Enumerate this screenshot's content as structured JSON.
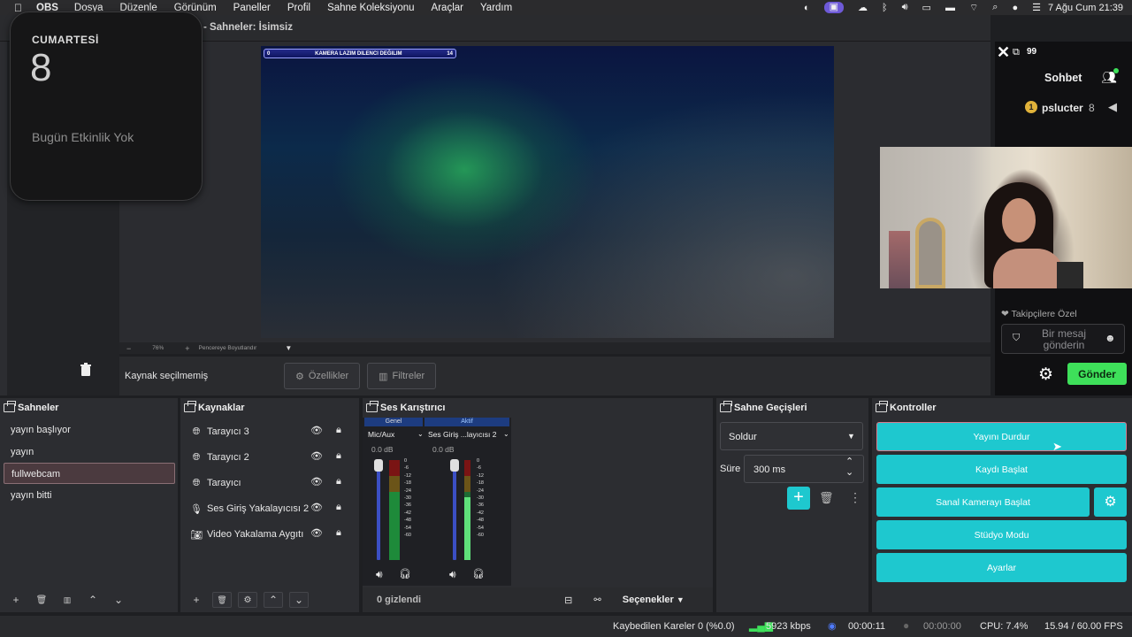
{
  "menubar": {
    "app_name": "OBS",
    "items": [
      "Dosya",
      "Düzenle",
      "Görünüm",
      "Paneller",
      "Profil",
      "Sahne Koleksiyonu",
      "Araçlar",
      "Yardım"
    ],
    "clock": "7 Ağu Cum  21:39"
  },
  "window": {
    "title": "- Sahneler: İsimsiz"
  },
  "calendar": {
    "weekday": "CUMARTESİ",
    "day": "8",
    "no_events": "Bugün Etkinlik Yok"
  },
  "preview": {
    "scoreboard": {
      "left": "0",
      "text": "KAMERA LAZIM DILENCI DEĞILIM",
      "right": "14"
    },
    "zoom": {
      "minus": "−",
      "level": "76%",
      "plus": "+",
      "fit": "Pencereye Boyutlandır"
    }
  },
  "source_toolbar": {
    "label": "Kaynak seçilmemiş",
    "properties": "Özellikler",
    "filters": "Filtreler"
  },
  "chat": {
    "count": "99",
    "title": "Sohbet",
    "message_user": "pslucter",
    "message_num": "8",
    "badge": "1",
    "followers_only": "Takipçilere Özel",
    "input_placeholder": "Bir mesaj gönderin",
    "send": "Gönder"
  },
  "scenes": {
    "title": "Sahneler",
    "items": [
      "yayın başlıyor",
      "yayın",
      "fullwebcam",
      "yayın bitti"
    ],
    "selected_index": 2
  },
  "sources": {
    "title": "Kaynaklar",
    "items": [
      {
        "label": "Tarayıcı 3",
        "icon": "globe-icon"
      },
      {
        "label": "Tarayıcı 2",
        "icon": "globe-icon"
      },
      {
        "label": "Tarayıcı",
        "icon": "globe-icon"
      },
      {
        "label": "Ses Giriş Yakalayıcısı 2",
        "icon": "microphone-icon"
      },
      {
        "label": "Video Yakalama Aygıtı",
        "icon": "camera-icon"
      }
    ]
  },
  "mixer": {
    "title": "Ses Karıştırıcı",
    "tabs": [
      "Genel",
      "Aktif"
    ],
    "channels": [
      {
        "name": "Mic/Aux",
        "db": "0.0 dB"
      },
      {
        "name": "Ses Giriş ...layıcısı 2",
        "db": "0.0 dB"
      }
    ],
    "scale": [
      "0",
      "-6",
      "-12",
      "-18",
      "-24",
      "-30",
      "-36",
      "-42",
      "-48",
      "-54",
      "-60"
    ],
    "hidden": "0 gizlendi",
    "options": "Seçenekler"
  },
  "transitions": {
    "title": "Sahne Geçişleri",
    "selected": "Soldur",
    "duration_label": "Süre",
    "duration_value": "300 ms"
  },
  "controls": {
    "title": "Kontroller",
    "stop_stream": "Yayını Durdur",
    "start_record": "Kaydı Başlat",
    "start_virtualcam": "Sanal Kamerayı Başlat",
    "studio_mode": "Stüdyo Modu",
    "settings": "Ayarlar"
  },
  "status": {
    "dropped": "Kaybedilen Kareler 0 (%0.0)",
    "bitrate": "5923 kbps",
    "live_time": "00:00:11",
    "rec_time": "00:00:00",
    "cpu": "CPU: 7.4%",
    "fps": "15.94 / 60.00 FPS"
  },
  "colors": {
    "accent": "#1ec8cf",
    "send": "#3ee05a",
    "selected_scene": "#4b3a3f"
  }
}
